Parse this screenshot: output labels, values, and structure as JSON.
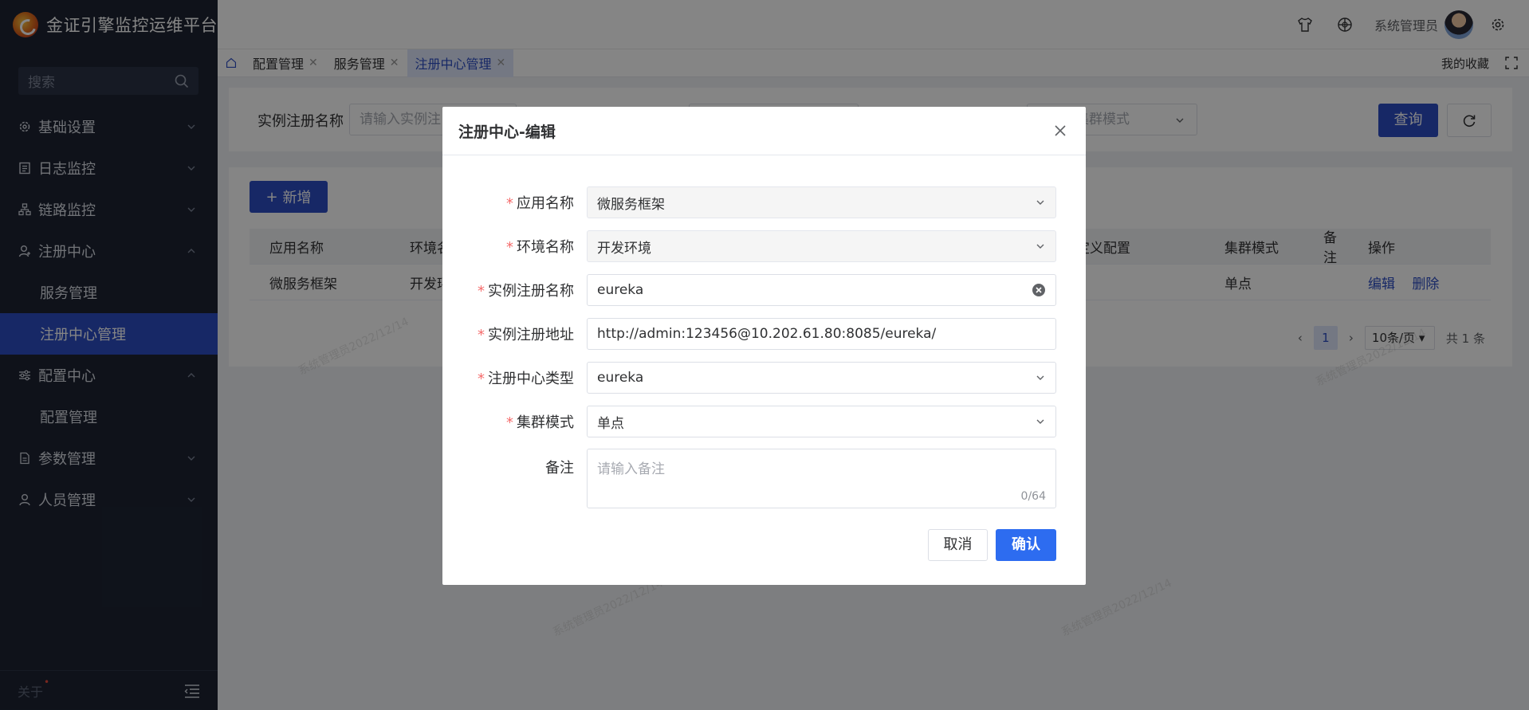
{
  "app": {
    "title": "金证引擎监控运维平台"
  },
  "sidebar": {
    "search_placeholder": "搜索",
    "menu": [
      {
        "label": "基础设置",
        "icon": "gear-icon",
        "expanded": false
      },
      {
        "label": "日志监控",
        "icon": "document-icon",
        "expanded": false
      },
      {
        "label": "链路监控",
        "icon": "tree-icon",
        "expanded": false
      },
      {
        "label": "注册中心",
        "icon": "user-icon",
        "expanded": true,
        "children": [
          {
            "label": "服务管理",
            "active": false
          },
          {
            "label": "注册中心管理",
            "active": true
          }
        ]
      },
      {
        "label": "配置中心",
        "icon": "sliders-icon",
        "expanded": true,
        "children": [
          {
            "label": "配置管理",
            "active": false
          }
        ]
      },
      {
        "label": "参数管理",
        "icon": "file-icon",
        "expanded": false
      },
      {
        "label": "人员管理",
        "icon": "person-icon",
        "expanded": false
      }
    ],
    "footer_about": "关于",
    "footer_dot": "•"
  },
  "header": {
    "user_name": "系统管理员"
  },
  "tabs": [
    {
      "label": "配置管理",
      "active": false
    },
    {
      "label": "服务管理",
      "active": false
    },
    {
      "label": "注册中心管理",
      "active": true
    }
  ],
  "tabs_right": {
    "favorites": "我的收藏"
  },
  "search": {
    "label": "实例注册名称",
    "placeholder": "请输入实例注",
    "cluster_placeholder": "集群模式",
    "query_button": "查询"
  },
  "table": {
    "add_button": "新增",
    "headers": [
      "应用名称",
      "环境名",
      "定义配置",
      "集群模式",
      "备注",
      "操作"
    ],
    "rows": [
      {
        "app": "微服务框架",
        "env": "开发环",
        "cluster": "单点",
        "edit": "编辑",
        "delete": "删除"
      }
    ],
    "pagination": {
      "page": "1",
      "page_size": "10条/页",
      "total": "共 1 条"
    }
  },
  "watermark": "系统管理员2022/12/14",
  "dialog": {
    "title": "注册中心-编辑",
    "fields": [
      {
        "label": "应用名称",
        "value": "微服务框架",
        "type": "select",
        "disabled": true,
        "required": true
      },
      {
        "label": "环境名称",
        "value": "开发环境",
        "type": "select",
        "disabled": true,
        "required": true
      },
      {
        "label": "实例注册名称",
        "value": "eureka",
        "type": "input-clearable",
        "required": true
      },
      {
        "label": "实例注册地址",
        "value": "http://admin:123456@10.202.61.80:8085/eureka/",
        "type": "input",
        "required": true
      },
      {
        "label": "注册中心类型",
        "value": "eureka",
        "type": "select",
        "required": true
      },
      {
        "label": "集群模式",
        "value": "单点",
        "type": "select",
        "required": true
      }
    ],
    "remark": {
      "label": "备注",
      "placeholder": "请输入备注",
      "count": "0/64"
    },
    "cancel": "取消",
    "confirm": "确认",
    "required_mark": "*"
  }
}
